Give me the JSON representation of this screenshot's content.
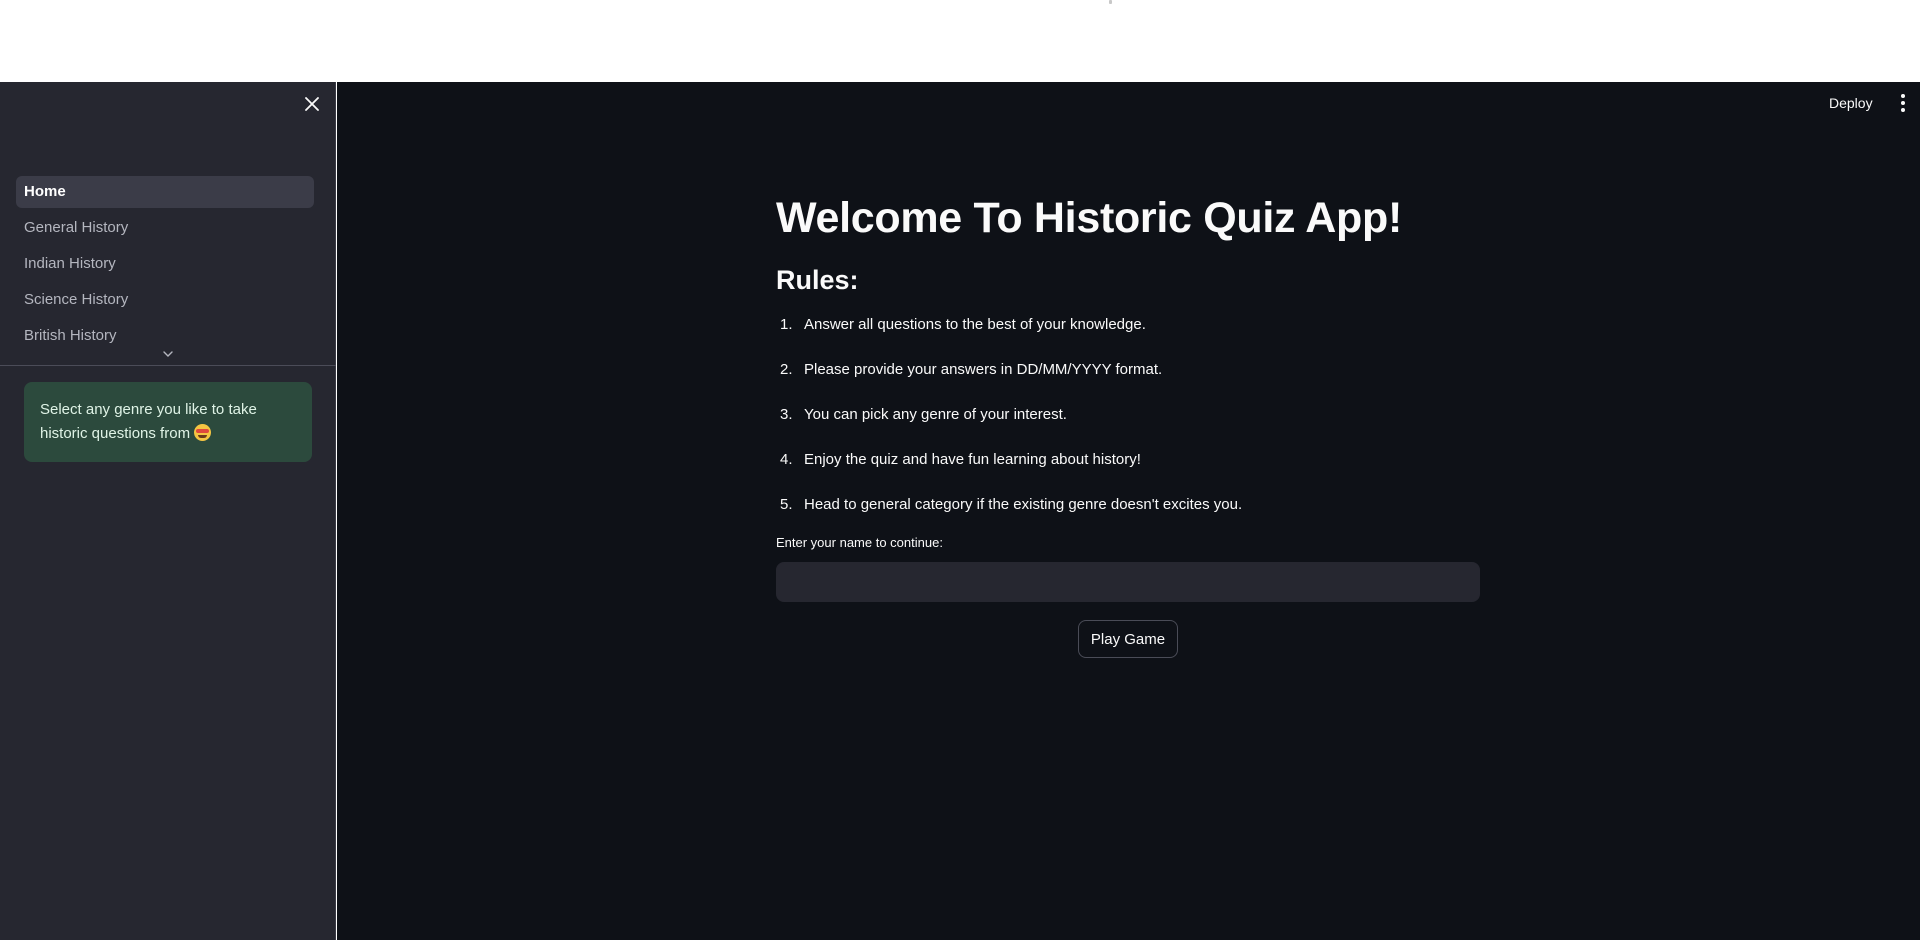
{
  "sidebar": {
    "nav_items": [
      {
        "label": "Home",
        "active": true
      },
      {
        "label": "General History",
        "active": false
      },
      {
        "label": "Indian History",
        "active": false
      },
      {
        "label": "Science History",
        "active": false
      },
      {
        "label": "British History",
        "active": false
      }
    ],
    "info_text": "Select any genre you like to take historic questions from",
    "info_emoji": "smiling-face-with-heart-eyes"
  },
  "header": {
    "deploy_label": "Deploy"
  },
  "main": {
    "title": "Welcome To Historic Quiz App!",
    "rules_heading": "Rules:",
    "rules": [
      {
        "num": "1.",
        "text": "Answer all questions to the best of your knowledge."
      },
      {
        "num": "2.",
        "text": "Please provide your answers in DD/MM/YYYY format."
      },
      {
        "num": "3.",
        "text": "You can pick any genre of your interest."
      },
      {
        "num": "4.",
        "text": "Enjoy the quiz and have fun learning about history!"
      },
      {
        "num": "5.",
        "text": "Head to general category if the existing genre doesn't excites you."
      }
    ],
    "name_label": "Enter your name to continue:",
    "name_value": "",
    "play_label": "Play Game"
  },
  "colors": {
    "main_bg": "#0e1117",
    "sidebar_bg": "#262730",
    "active_nav_bg": "#3b3c48",
    "info_bg": "#2c4a3d",
    "text": "#fafafa"
  }
}
